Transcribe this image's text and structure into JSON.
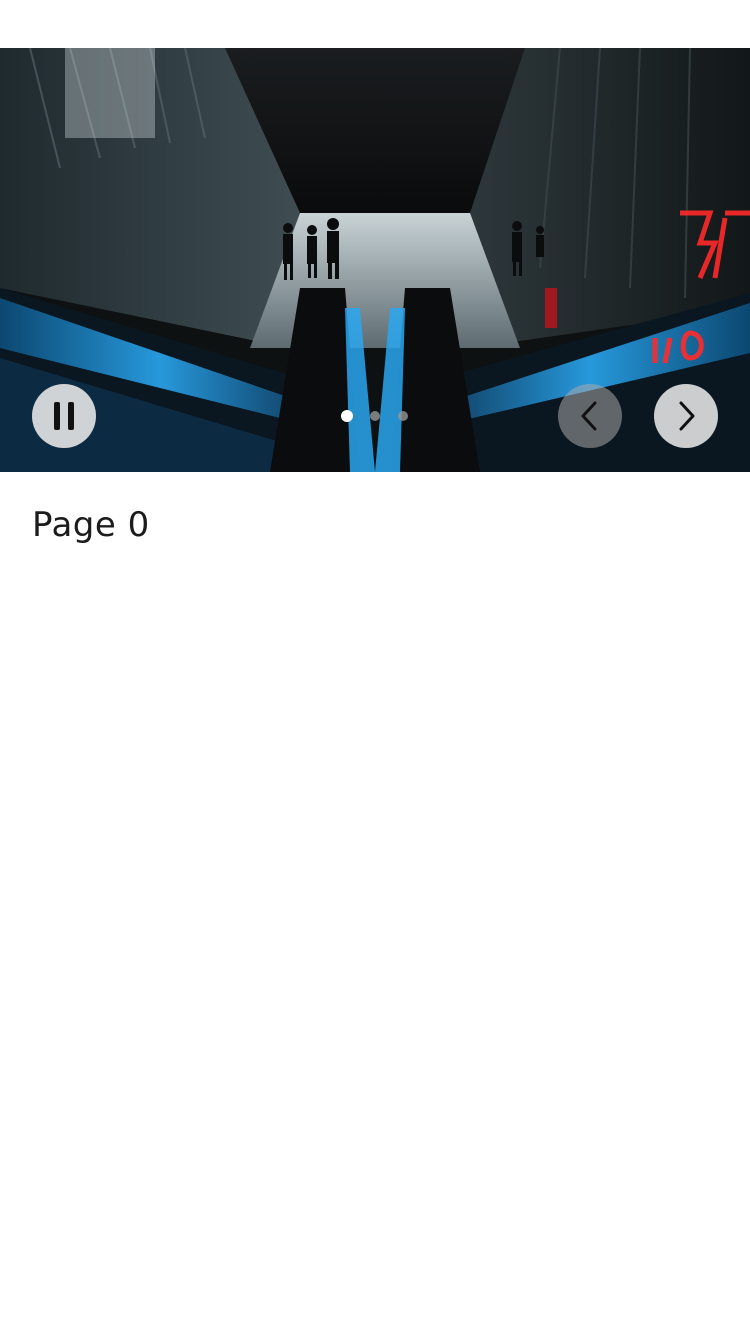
{
  "carousel": {
    "pause_icon": "pause-icon",
    "prev_icon": "chevron-left-icon",
    "next_icon": "chevron-right-icon",
    "slide_count": 3,
    "active_slide": 0
  },
  "content": {
    "page_label": "Page 0"
  },
  "colors": {
    "neon_blue": "#2aa7f0",
    "neon_red": "#ff2a2a",
    "background": "#ffffff"
  }
}
